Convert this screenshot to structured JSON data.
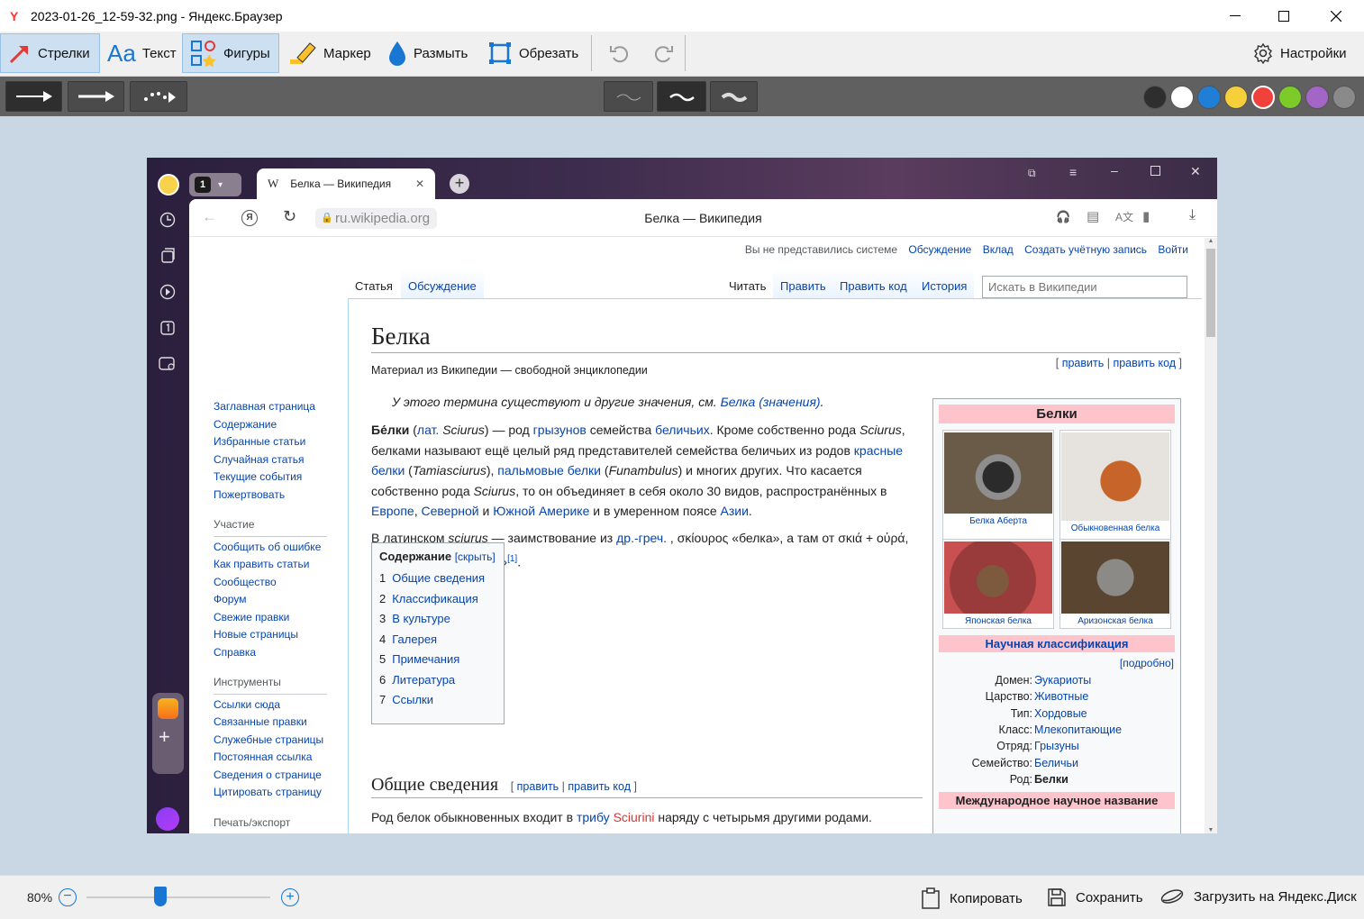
{
  "window": {
    "title": "2023-01-26_12-59-32.png - Яндекс.Браузер"
  },
  "toolbar": {
    "arrows": "Стрелки",
    "text": "Текст",
    "shapes": "Фигуры",
    "marker": "Маркер",
    "blur": "Размыть",
    "crop": "Обрезать",
    "settings": "Настройки"
  },
  "colors": [
    "#2e2e2e",
    "#ffffff",
    "#1f7fd6",
    "#f6cf3a",
    "#f0413d",
    "#7ccb28",
    "#a466c6",
    "#8a8a8a"
  ],
  "browser": {
    "tab_title": "Белка — Википедия",
    "tab_counter": "1",
    "url": "ru.wikipedia.org",
    "page_title": "Белка — Википедия"
  },
  "wiki": {
    "personal": {
      "notlogged": "Вы не представились системе",
      "talk": "Обсуждение",
      "contrib": "Вклад",
      "create": "Создать учётную запись",
      "login": "Войти"
    },
    "tabs": {
      "article": "Статья",
      "discussion": "Обсуждение",
      "read": "Читать",
      "edit": "Править",
      "editsrc": "Править код",
      "history": "История"
    },
    "search_placeholder": "Искать в Википедии",
    "sidebar": {
      "nav": [
        "Заглавная страница",
        "Содержание",
        "Избранные статьи",
        "Случайная статья",
        "Текущие события",
        "Пожертвовать"
      ],
      "part_hd": "Участие",
      "part": [
        "Сообщить об ошибке",
        "Как править статьи",
        "Сообщество",
        "Форум",
        "Свежие правки",
        "Новые страницы",
        "Справка"
      ],
      "tools_hd": "Инструменты",
      "tools": [
        "Ссылки сюда",
        "Связанные правки",
        "Служебные страницы",
        "Постоянная ссылка",
        "Сведения о странице",
        "Цитировать страницу"
      ],
      "print_hd": "Печать/экспорт"
    },
    "title": "Белка",
    "tagline": "Материал из Википедии — свободной энциклопедии",
    "editlinks": {
      "open": "[ ",
      "edit": "править",
      "sep": " | ",
      "editsrc": "править код",
      "close": " ]"
    },
    "hatnote": {
      "text": "У этого термина существуют и другие значения, см. ",
      "link": "Белка (значения)",
      "end": "."
    },
    "para1": {
      "b": "Бе́лки",
      "t1": " (",
      "lat": "лат.",
      "t2": " ",
      "sciurus": "Sciurus",
      "t3": ") — род ",
      "rodents": "грызунов",
      "t4": " семейства ",
      "belich": "беличьих",
      "t5": ". Кроме собственно рода ",
      "sciurus2": "Sciurus",
      "t6": ", белками называют ещё целый ряд представителей семейства беличьих из родов ",
      "red": "красные белки",
      "t7": " (",
      "tamias": "Tamiasciurus",
      "t8": "), ",
      "palm": "пальмовые белки",
      "t9": " (",
      "funamb": "Funambulus",
      "t10": ") и многих других. Что касается собственно рода ",
      "sciurus3": "Sciurus",
      "t11": ", то он объединяет в себя около 30 видов, распространённых в ",
      "europe": "Европе",
      "c1": ", ",
      "north": "Северной",
      "t12": " и ",
      "south": "Южной Америке",
      "t13": " и в умеренном поясе ",
      "asia": "Азии",
      "t14": "."
    },
    "para2": {
      "t1": "В латинском ",
      "sciurus": "sciurus",
      "t2": " — заимствование из ",
      "greek": "др.-греч.",
      "t3": " , σκίουρος «белка», а там от σκιά + οὐρά, буквально «тенехвост»",
      "ref": "[1]",
      "t4": "."
    },
    "toc": {
      "title": "Содержание",
      "hide": "[скрыть]",
      "items": [
        {
          "n": "1",
          "t": "Общие сведения"
        },
        {
          "n": "2",
          "t": "Классификация"
        },
        {
          "n": "3",
          "t": "В культуре"
        },
        {
          "n": "4",
          "t": "Галерея"
        },
        {
          "n": "5",
          "t": "Примечания"
        },
        {
          "n": "6",
          "t": "Литература"
        },
        {
          "n": "7",
          "t": "Ссылки"
        }
      ]
    },
    "h2": "Общие сведения",
    "h2_edit": {
      "open": "[ ",
      "edit": "править",
      "sep": " | ",
      "editsrc": "править код",
      "close": " ]"
    },
    "para3": {
      "t1": "Род белок обыкновенных входит в ",
      "tribe": "трибу",
      "t2": " ",
      "sciurini": "Sciurini",
      "t3": " наряду с четырьмя другими родами."
    },
    "infobox": {
      "title": "Белки",
      "captions": [
        "Белка Аберта",
        "Обыкновенная белка",
        "Японская белка",
        "Аризонская белка"
      ],
      "sci_hd": "Научная классификация",
      "more": "[подробно]",
      "rows": [
        {
          "k": "Домен:",
          "v": "Эукариоты"
        },
        {
          "k": "Царство:",
          "v": "Животные"
        },
        {
          "k": "Тип:",
          "v": "Хордовые"
        },
        {
          "k": "Класс:",
          "v": "Млекопитающие"
        },
        {
          "k": "Отряд:",
          "v": "Грызуны"
        },
        {
          "k": "Семейство:",
          "v": "Беличьи"
        },
        {
          "k": "Род:",
          "v": "Белки"
        }
      ],
      "intl_hd": "Международное научное название"
    }
  },
  "bottom": {
    "zoom": "80%",
    "zoom_fraction": 0.4,
    "copy": "Копировать",
    "save": "Сохранить",
    "upload": "Загрузить на Яндекс.Диск"
  }
}
